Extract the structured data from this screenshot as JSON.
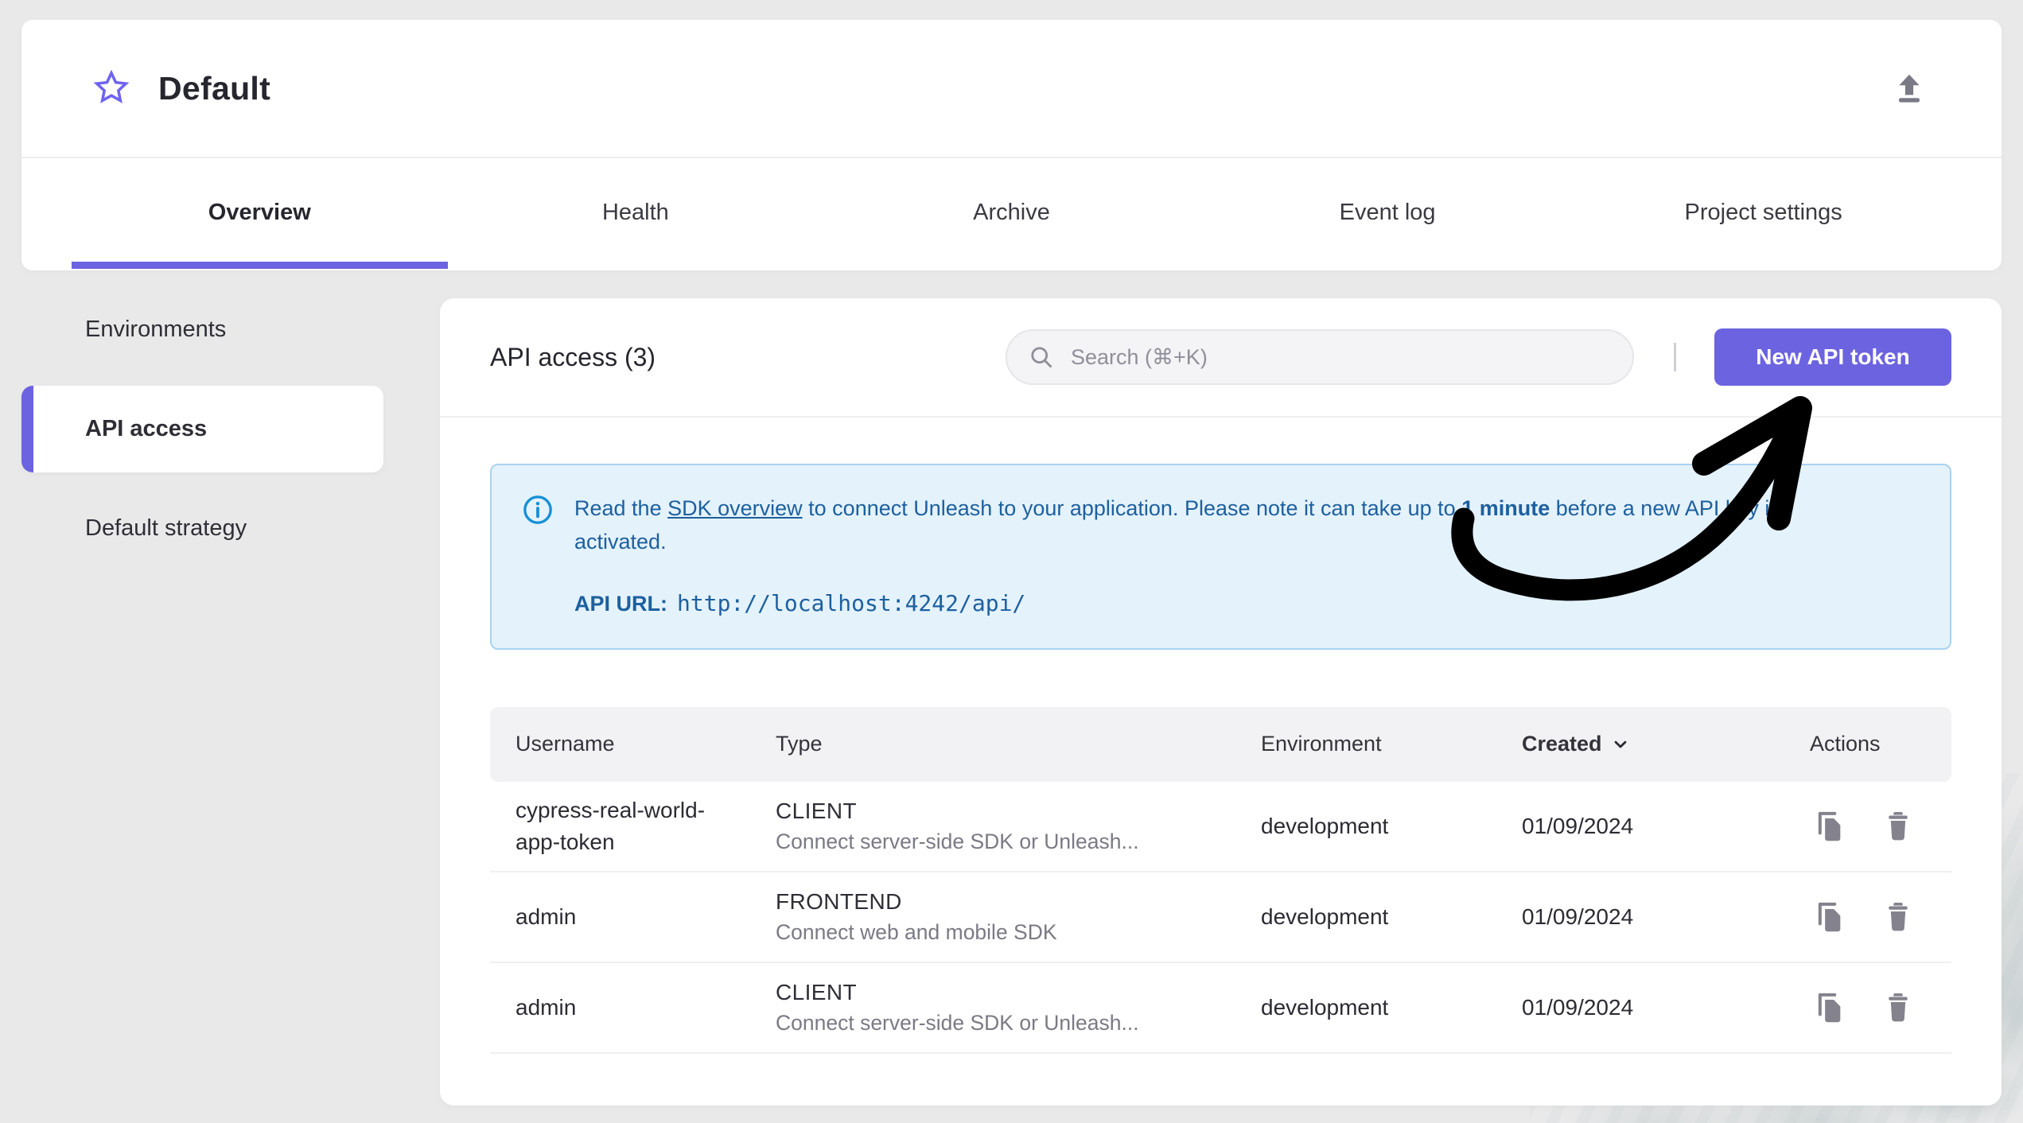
{
  "colors": {
    "accent": "#6C63E0",
    "accent-star": "#6F63F2",
    "alert-bg": "#E4F2FC",
    "alert-border": "#A9D3F0",
    "alert-text": "#1D609F",
    "info-icon": "#1690D6",
    "icon-gray": "#83828D"
  },
  "project_header": {
    "title": "Default",
    "favorite_icon": "star-outline-icon",
    "export_icon": "upload-icon"
  },
  "tabs": [
    {
      "label": "Overview",
      "active": true
    },
    {
      "label": "Health",
      "active": false
    },
    {
      "label": "Archive",
      "active": false
    },
    {
      "label": "Event log",
      "active": false
    },
    {
      "label": "Project settings",
      "active": false
    }
  ],
  "sidebar": {
    "items": [
      {
        "label": "Environments",
        "active": false
      },
      {
        "label": "API access",
        "active": true
      },
      {
        "label": "Default strategy",
        "active": false
      }
    ]
  },
  "api_access": {
    "title": "API access (3)",
    "search": {
      "placeholder": "Search (⌘+K)",
      "icon": "magnifier-icon"
    },
    "new_token_button_label": "New API token",
    "alert": {
      "icon": "info-circle-icon",
      "text_prefix": "Read the ",
      "link_label": "SDK overview",
      "text_middle": " to connect Unleash to your application. Please note it can take up to ",
      "emphasis": "1 minute",
      "text_suffix": " before a new API key is activated.",
      "api_url_label": "API URL:",
      "api_url_value": "http://localhost:4242/api/"
    },
    "table": {
      "columns": [
        "Username",
        "Type",
        "Environment",
        "Created",
        "Actions"
      ],
      "sort": {
        "column": "Created",
        "icon": "chevron-down-icon"
      },
      "rows": [
        {
          "username": "cypress-real-world-app-token",
          "type": "CLIENT",
          "type_description": "Connect server-side SDK or Unleash...",
          "environment": "development",
          "created": "01/09/2024"
        },
        {
          "username": "admin",
          "type": "FRONTEND",
          "type_description": "Connect web and mobile SDK",
          "environment": "development",
          "created": "01/09/2024"
        },
        {
          "username": "admin",
          "type": "CLIENT",
          "type_description": "Connect server-side SDK or Unleash...",
          "environment": "development",
          "created": "01/09/2024"
        }
      ],
      "row_action_icons": [
        "copy-icon",
        "trash-icon"
      ]
    }
  },
  "annotation": {
    "type": "hand-drawn-arrow",
    "color": "#000000",
    "points_at": "New API token button"
  }
}
